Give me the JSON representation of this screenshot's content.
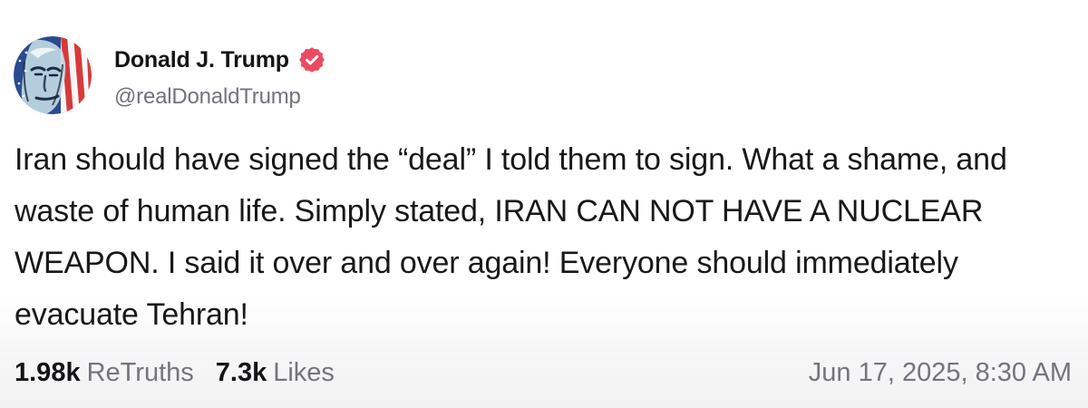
{
  "post": {
    "author": {
      "display_name": "Donald J. Trump",
      "handle": "@realDonaldTrump",
      "verified_icon": "verified-badge-icon",
      "avatar_icon": "profile-avatar"
    },
    "text": "Iran should have signed the “deal” I told them to sign. What a shame, and waste of human life. Simply stated, IRAN CAN NOT HAVE A NUCLEAR WEAPON. I said it over and over again! Everyone should immediately evacuate Tehran!",
    "stats": {
      "retruths_count": "1.98k",
      "retruths_label": "ReTruths",
      "likes_count": "7.3k",
      "likes_label": "Likes"
    },
    "timestamp": "Jun 17, 2025, 8:30 AM"
  },
  "colors": {
    "verified_badge": "#e94b62",
    "name_text": "#141417",
    "secondary_text": "#74747e"
  }
}
